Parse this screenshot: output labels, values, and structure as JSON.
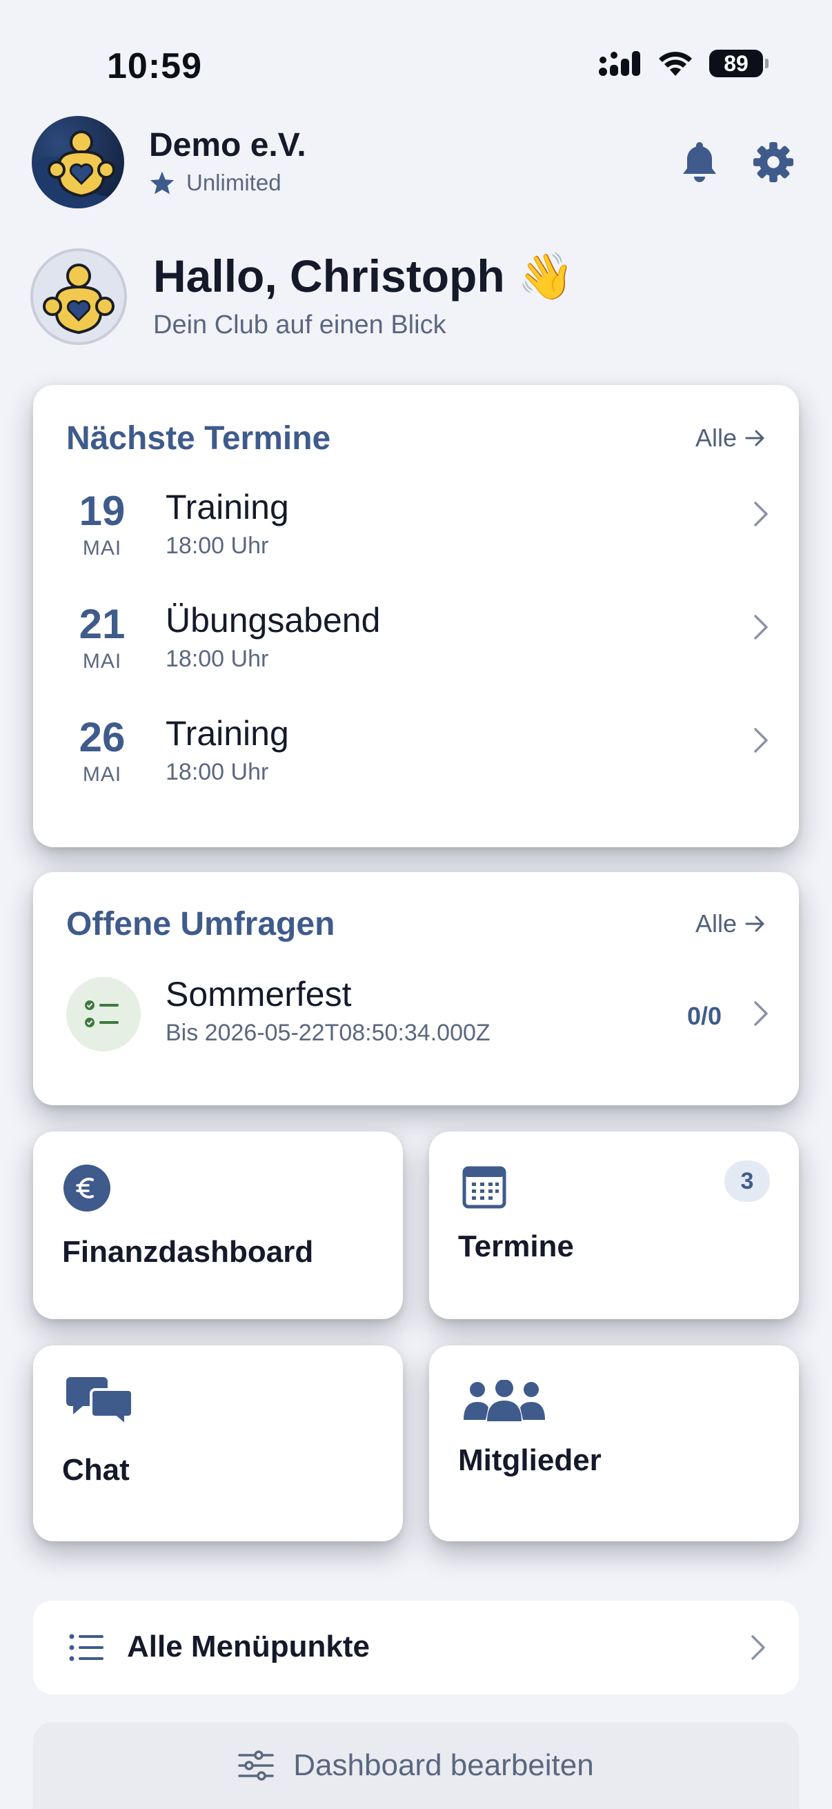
{
  "status_bar": {
    "time": "10:59",
    "battery": "89"
  },
  "header": {
    "club_name": "Demo e.V.",
    "plan": "Unlimited",
    "greeting": "Hallo, Christoph",
    "greeting_emoji": "👋",
    "tagline": "Dein Club auf einen Blick"
  },
  "events_card": {
    "title": "Nächste Termine",
    "all_label": "Alle",
    "items": [
      {
        "day": "19",
        "month": "MAI",
        "title": "Training",
        "time": "18:00 Uhr"
      },
      {
        "day": "21",
        "month": "MAI",
        "title": "Übungsabend",
        "time": "18:00 Uhr"
      },
      {
        "day": "26",
        "month": "MAI",
        "title": "Training",
        "time": "18:00 Uhr"
      }
    ]
  },
  "polls_card": {
    "title": "Offene Umfragen",
    "all_label": "Alle",
    "items": [
      {
        "title": "Sommerfest",
        "deadline": "Bis 2026-05-22T08:50:34.000Z",
        "count": "0/0"
      }
    ]
  },
  "tiles": {
    "finance": {
      "label": "Finanzdashboard",
      "icon": "euro-icon"
    },
    "events": {
      "label": "Termine",
      "icon": "calendar-icon",
      "badge": "3"
    },
    "chat": {
      "label": "Chat",
      "icon": "chat-bubbles-icon"
    },
    "members": {
      "label": "Mitglieder",
      "icon": "members-icon"
    }
  },
  "menu": {
    "all_items_label": "Alle Menüpunkte",
    "edit_dashboard_label": "Dashboard bearbeiten"
  },
  "colors": {
    "accent": "#3f5b8c",
    "background": "#f2f3f8",
    "card": "#ffffff",
    "text": "#141a2a",
    "muted": "#5a6780"
  }
}
